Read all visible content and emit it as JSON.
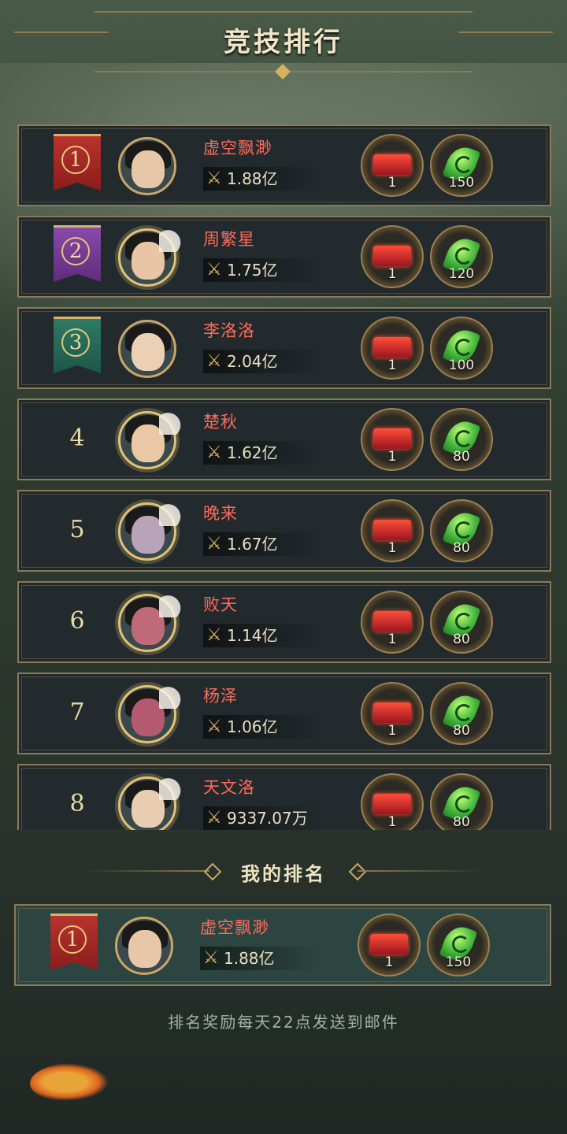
{
  "header": {
    "title": "竞技排行"
  },
  "rankings": [
    {
      "rank": "1",
      "banner": "r1",
      "name": "虚空飘渺",
      "power": "1.88亿",
      "title_reward": "",
      "title_count": "1",
      "jade_count": "150",
      "face": "#e7c7a8",
      "ornate": false
    },
    {
      "rank": "2",
      "banner": "r2",
      "name": "周繁星",
      "power": "1.75亿",
      "title_reward": "",
      "title_count": "1",
      "jade_count": "120",
      "face": "#e8c5a4",
      "ornate": true
    },
    {
      "rank": "3",
      "banner": "r3",
      "name": "李洛洛",
      "power": "2.04亿",
      "title_reward": "",
      "title_count": "1",
      "jade_count": "100",
      "face": "#ecd0b5",
      "ornate": false
    },
    {
      "rank": "4",
      "banner": "",
      "name": "楚秋",
      "power": "1.62亿",
      "title_reward": "",
      "title_count": "1",
      "jade_count": "80",
      "face": "#eac8a6",
      "ornate": true
    },
    {
      "rank": "5",
      "banner": "",
      "name": "晚来",
      "power": "1.67亿",
      "title_reward": "",
      "title_count": "1",
      "jade_count": "80",
      "face": "#b9a3b8",
      "ornate": true
    },
    {
      "rank": "6",
      "banner": "",
      "name": "败天",
      "power": "1.14亿",
      "title_reward": "",
      "title_count": "1",
      "jade_count": "80",
      "face": "#c06a78",
      "ornate": true
    },
    {
      "rank": "7",
      "banner": "",
      "name": "杨泽",
      "power": "1.06亿",
      "title_reward": "",
      "title_count": "1",
      "jade_count": "80",
      "face": "#b35a72",
      "ornate": true
    },
    {
      "rank": "8",
      "banner": "",
      "name": "天文洛",
      "power": "9337.07万",
      "title_reward": "",
      "title_count": "1",
      "jade_count": "80",
      "face": "#e9cdb2",
      "ornate": true
    }
  ],
  "my_rank": {
    "heading": "我的排名",
    "rank": "1",
    "banner": "r1",
    "name": "虚空飘渺",
    "power": "1.88亿",
    "title_count": "1",
    "jade_count": "150",
    "face": "#e7c7a8"
  },
  "footer_note": "排名奖励每天22点发送到邮件",
  "icons": {
    "power": "crossed-swords-icon",
    "reward_title": "title-badge-icon",
    "reward_jade": "jade-token-icon",
    "koi": "koi-fish-icon"
  },
  "colors": {
    "name": "#ff6a5a",
    "gold": "#c9a664",
    "panel": "#222a2d",
    "my_panel": "#2c4540"
  }
}
